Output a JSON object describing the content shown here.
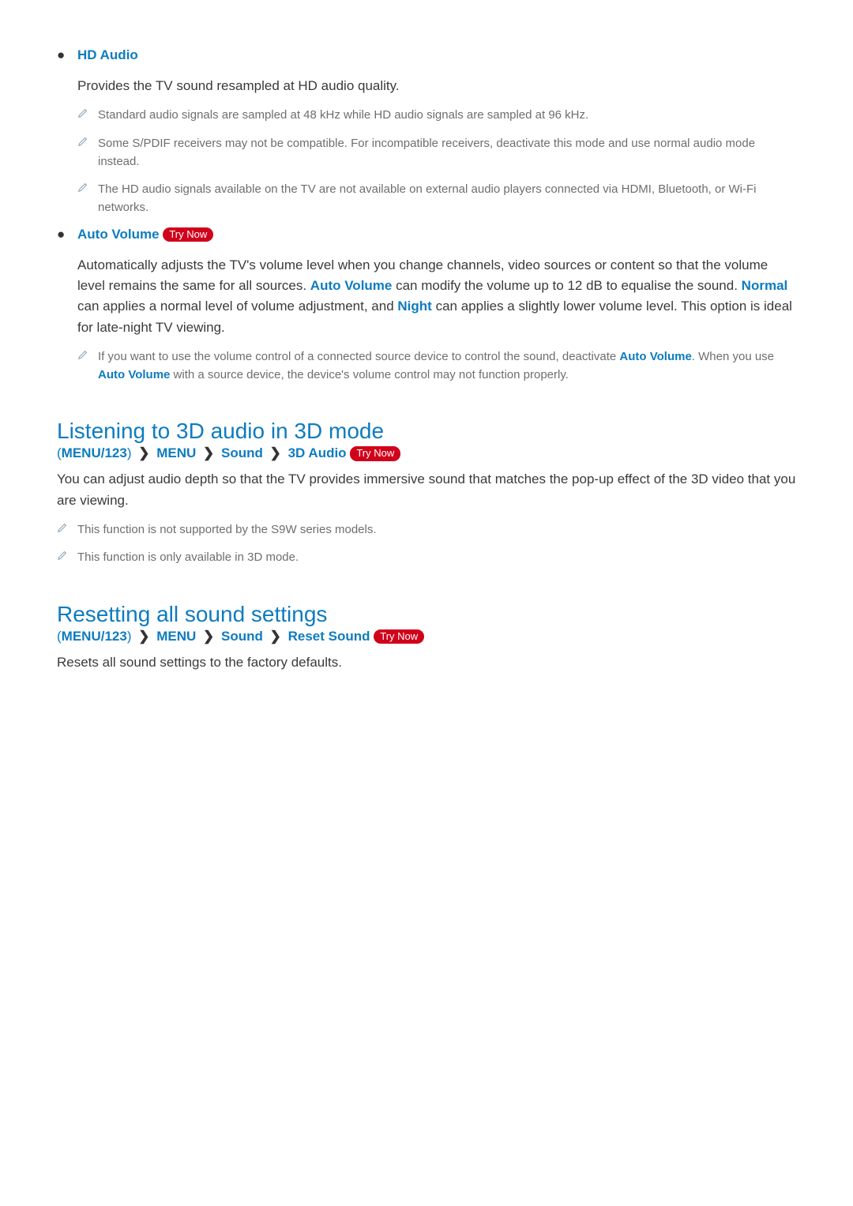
{
  "common": {
    "try_now": "Try Now"
  },
  "hd_audio": {
    "title": "HD Audio",
    "desc": "Provides the TV sound resampled at HD audio quality.",
    "notes": [
      "Standard audio signals are sampled at 48 kHz while HD audio signals are sampled at 96 kHz.",
      "Some S/PDIF receivers may not be compatible. For incompatible receivers, deactivate this mode and use normal audio mode instead.",
      "The HD audio signals available on the TV are not available on external audio players connected via HDMI, Bluetooth, or Wi-Fi networks."
    ]
  },
  "auto_volume": {
    "title": "Auto Volume",
    "desc_parts": {
      "p1": "Automatically adjusts the TV's volume level when you change channels, video sources or content so that the volume level remains the same for all sources. ",
      "k1": "Auto Volume",
      "p2": " can modify the volume up to 12 dB to equalise the sound. ",
      "k2": "Normal",
      "p3": " can applies a normal level of volume adjustment, and ",
      "k3": "Night",
      "p4": " can applies a slightly lower volume level. This option is ideal for late-night TV viewing."
    },
    "note_parts": {
      "p1": "If you want to use the volume control of a connected source device to control the sound, deactivate ",
      "k1": "Auto Volume",
      "p2": ". When you use ",
      "k2": "Auto Volume",
      "p3": " with a source device, the device's volume control may not function properly."
    }
  },
  "section_3d": {
    "title": "Listening to 3D audio in 3D mode",
    "breadcrumb": {
      "paren_open": "(",
      "menu123": "MENU/123",
      "paren_close": ")",
      "menu": "MENU",
      "sound": "Sound",
      "last": "3D Audio"
    },
    "desc": "You can adjust audio depth so that the TV provides immersive sound that matches the pop-up effect of the 3D video that you are viewing.",
    "notes": [
      "This function is not supported by the S9W series models.",
      "This function is only available in 3D mode."
    ]
  },
  "section_reset": {
    "title": "Resetting all sound settings",
    "breadcrumb": {
      "paren_open": "(",
      "menu123": "MENU/123",
      "paren_close": ")",
      "menu": "MENU",
      "sound": "Sound",
      "last": "Reset Sound"
    },
    "desc": "Resets all sound settings to the factory defaults."
  }
}
